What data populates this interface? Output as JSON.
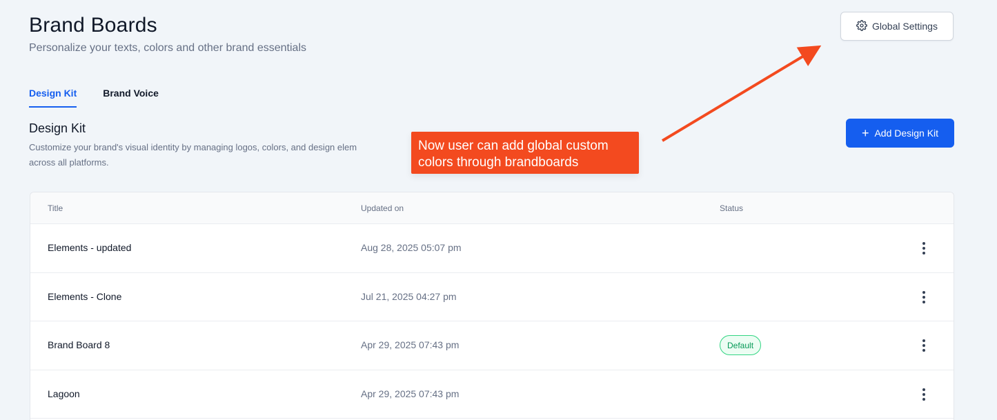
{
  "header": {
    "title": "Brand Boards",
    "subtitle": "Personalize your texts, colors and other brand essentials",
    "global_settings_label": "Global Settings"
  },
  "tabs": [
    {
      "label": "Design Kit",
      "active": true
    },
    {
      "label": "Brand Voice",
      "active": false
    }
  ],
  "section": {
    "title": "Design Kit",
    "description": "Customize your brand's visual identity by managing logos, colors, and design elem",
    "description_line2": "across all platforms.",
    "add_button_label": "Add Design Kit"
  },
  "annotation": {
    "text": "Now user can add global custom colors through brandboards",
    "color": "#f34a1f"
  },
  "table": {
    "columns": [
      "Title",
      "Updated on",
      "Status"
    ],
    "rows": [
      {
        "title": "Elements - updated",
        "updated_on": "Aug 28, 2025 05:07 pm",
        "status": ""
      },
      {
        "title": "Elements - Clone",
        "updated_on": "Jul 21, 2025 04:27 pm",
        "status": ""
      },
      {
        "title": "Brand Board 8",
        "updated_on": "Apr 29, 2025 07:43 pm",
        "status": "Default"
      },
      {
        "title": "Lagoon",
        "updated_on": "Apr 29, 2025 07:43 pm",
        "status": ""
      }
    ]
  },
  "colors": {
    "accent": "#155eef",
    "background": "#f1f5f9",
    "success": "#039855"
  },
  "icons": {
    "global_settings": "gear-icon",
    "add": "plus-icon",
    "row_menu": "kebab-menu-icon"
  }
}
